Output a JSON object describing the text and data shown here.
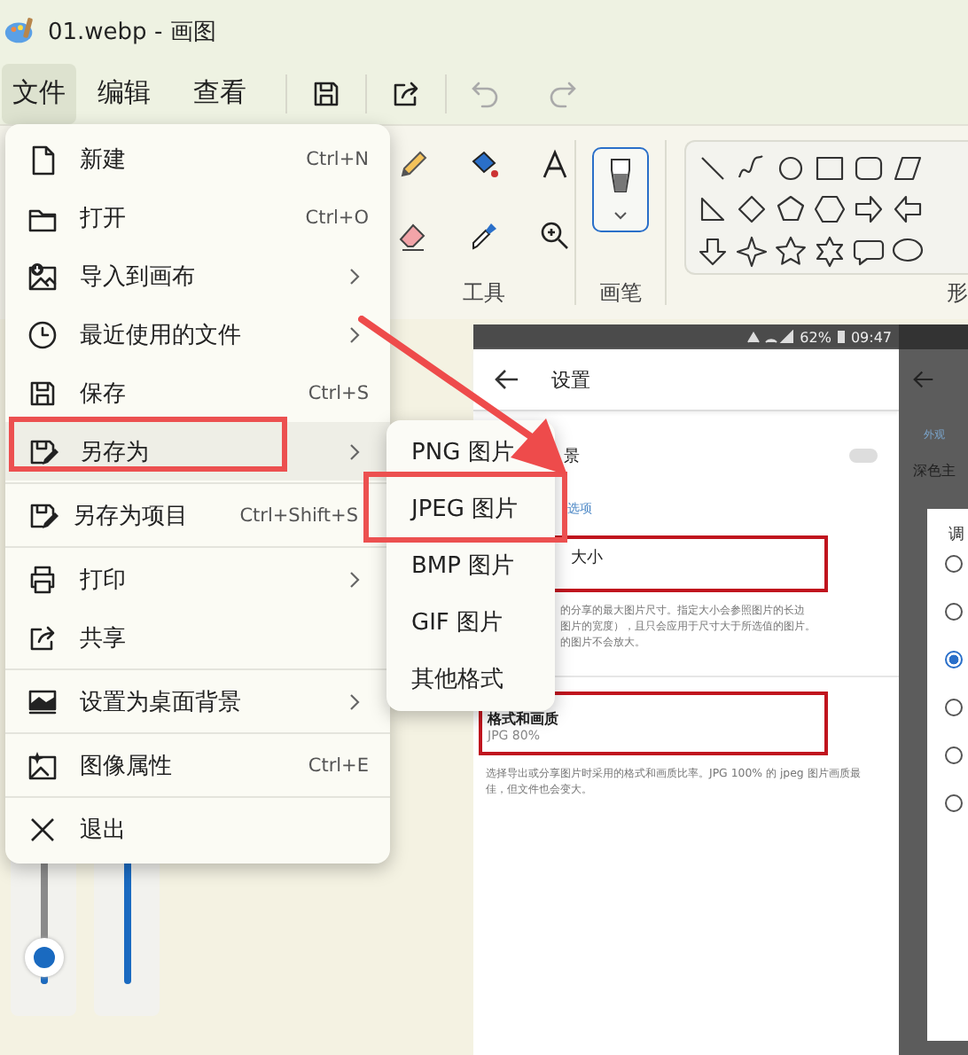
{
  "window": {
    "title": "01.webp - 画图"
  },
  "menubar": [
    {
      "label": "文件",
      "selected": true
    },
    {
      "label": "编辑",
      "selected": false
    },
    {
      "label": "查看",
      "selected": false
    }
  ],
  "ribbon": {
    "groups": [
      {
        "label": "工具"
      },
      {
        "label": "画笔"
      },
      {
        "label": "形"
      }
    ]
  },
  "file_menu": {
    "groups": [
      [
        {
          "label": "新建",
          "shortcut": "Ctrl+N",
          "submenu": false,
          "selected": false
        },
        {
          "label": "打开",
          "shortcut": "Ctrl+O",
          "submenu": false,
          "selected": false
        },
        {
          "label": "导入到画布",
          "submenu": true,
          "selected": false
        },
        {
          "label": "最近使用的文件",
          "submenu": true,
          "selected": false
        },
        {
          "label": "保存",
          "shortcut": "Ctrl+S",
          "submenu": false,
          "selected": false
        },
        {
          "label": "另存为",
          "submenu": true,
          "selected": true
        }
      ],
      [
        {
          "label": "另存为项目",
          "shortcut": "Ctrl+Shift+S",
          "submenu": false,
          "selected": false
        }
      ],
      [
        {
          "label": "打印",
          "submenu": true,
          "selected": false
        },
        {
          "label": "共享",
          "submenu": false,
          "selected": false
        }
      ],
      [
        {
          "label": "设置为桌面背景",
          "submenu": true,
          "selected": false
        }
      ],
      [
        {
          "label": "图像属性",
          "shortcut": "Ctrl+E",
          "submenu": false,
          "selected": false
        }
      ],
      [
        {
          "label": "退出",
          "submenu": false,
          "selected": false
        }
      ]
    ]
  },
  "save_as_menu": {
    "items": [
      {
        "label": "PNG 图片"
      },
      {
        "label": "JPEG 图片"
      },
      {
        "label": "BMP 图片"
      },
      {
        "label": "GIF 图片"
      },
      {
        "label": "其他格式"
      }
    ]
  },
  "annotations": [
    {
      "kind": "frame"
    },
    {
      "kind": "frame"
    },
    {
      "kind": "arrow"
    }
  ],
  "canvas_image": {
    "status_battery": "62%",
    "status_time": "09:47",
    "title": "设置",
    "toggle_on": false,
    "row_1": "景",
    "section": "选项",
    "option_1": "大小",
    "option_1_hint": [
      "的分享的最大图片尺寸。指定大小会参照图片的长边",
      "图片的宽度），且只会应用于尺寸大于所选值的图片。",
      "的图片不会放大。"
    ],
    "option_2": "格式和画质",
    "option_2_value": "JPG 80%",
    "option_2_hint": "选择导出或分享图片时采用的格式和画质比率。JPG 100% 的 jpeg 图片画质最佳，但文件也会变大。",
    "side_section": "外观",
    "side_row": "深色主",
    "dialog_title": "调",
    "dialog_options": [
      {
        "selected": false
      },
      {
        "selected": false
      },
      {
        "selected": true
      },
      {
        "selected": false
      },
      {
        "selected": false
      },
      {
        "selected": false
      }
    ]
  }
}
